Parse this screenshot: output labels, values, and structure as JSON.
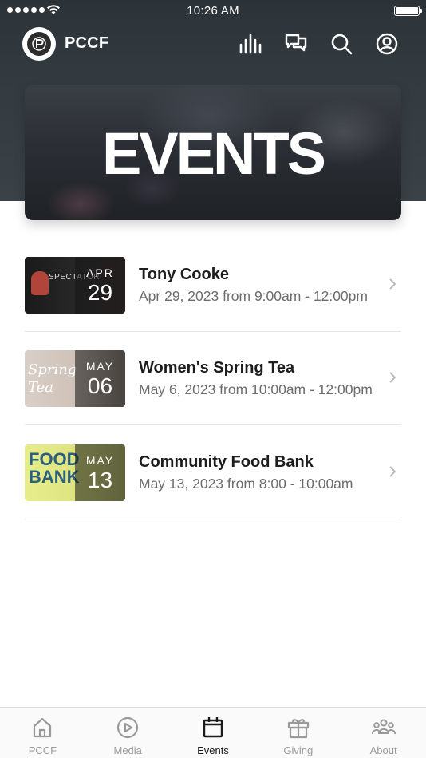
{
  "status_bar": {
    "time": "10:26 AM"
  },
  "app_bar": {
    "title": "PCCF"
  },
  "hero": {
    "title": "EVENTS"
  },
  "events": [
    {
      "title": "Tony Cooke",
      "subtitle": "Apr 29, 2023 from 9:00am - 12:00pm",
      "month": "APR",
      "day": "29"
    },
    {
      "title": "Women's Spring Tea",
      "subtitle": "May 6, 2023 from 10:00am - 12:00pm",
      "month": "MAY",
      "day": "06"
    },
    {
      "title": "Community Food Bank",
      "subtitle": "May 13, 2023 from 8:00 - 10:00am",
      "month": "MAY",
      "day": "13"
    }
  ],
  "tab_bar": {
    "tabs": [
      {
        "label": "PCCF",
        "icon": "home-icon",
        "active": false
      },
      {
        "label": "Media",
        "icon": "play-icon",
        "active": false
      },
      {
        "label": "Events",
        "icon": "calendar-icon",
        "active": true
      },
      {
        "label": "Giving",
        "icon": "gift-icon",
        "active": false
      },
      {
        "label": "About",
        "icon": "people-icon",
        "active": false
      }
    ]
  },
  "colors": {
    "header_bg": "#333b40",
    "active_tab": "#1b1b1b",
    "inactive_tab": "#9a9a9a"
  }
}
